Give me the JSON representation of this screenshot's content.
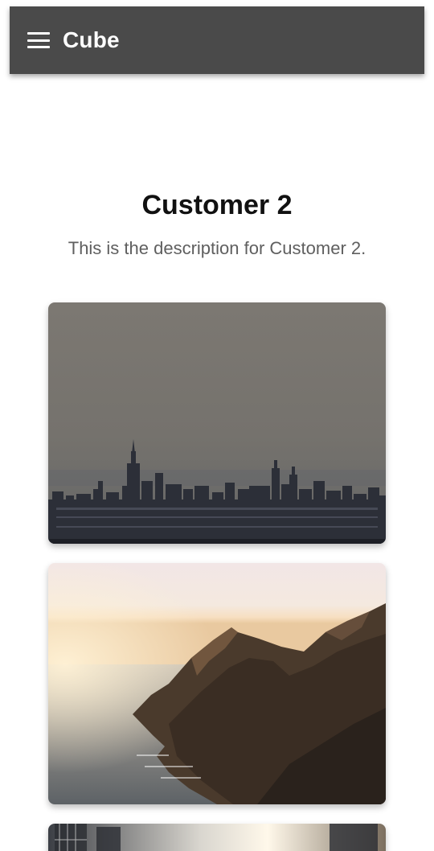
{
  "app_bar": {
    "title": "Cube",
    "background": "#4a4a4a"
  },
  "customer": {
    "title": "Customer 2",
    "description": "This is the description for Customer 2."
  },
  "images": [
    {
      "name": "city-skyline-photo",
      "icon": "city-skyline"
    },
    {
      "name": "coastal-cliffs-photo",
      "icon": "sea-cliffs-sunset"
    },
    {
      "name": "city-street-photo",
      "icon": "sunlit-buildings"
    }
  ]
}
